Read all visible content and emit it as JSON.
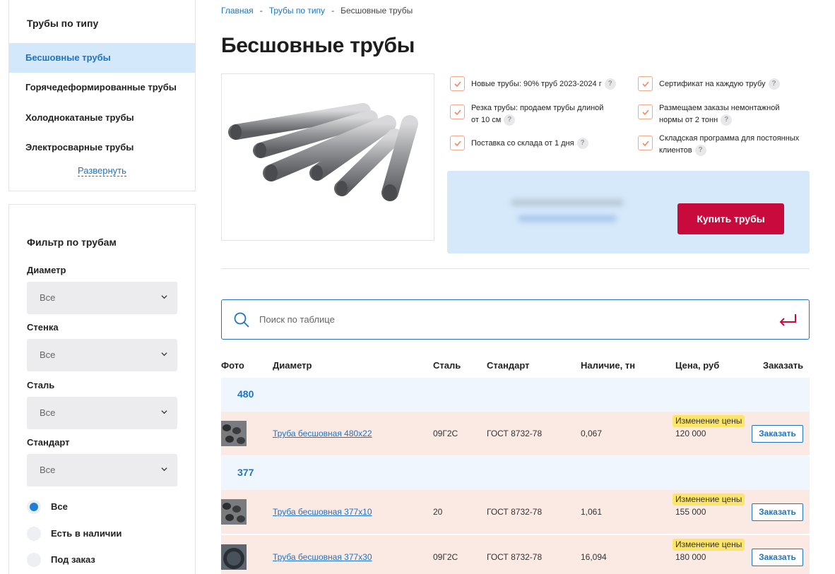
{
  "sidebar": {
    "types_title": "Трубы по типу",
    "types": [
      {
        "label": "Бесшовные трубы",
        "active": true
      },
      {
        "label": "Горячедеформированные трубы",
        "active": false
      },
      {
        "label": "Холоднокатаные трубы",
        "active": false
      },
      {
        "label": "Электросварные трубы",
        "active": false
      }
    ],
    "expand_label": "Развернуть",
    "filter_title": "Фильтр по трубам",
    "filters": [
      {
        "label": "Диаметр",
        "value": "Все"
      },
      {
        "label": "Стенка",
        "value": "Все"
      },
      {
        "label": "Сталь",
        "value": "Все"
      },
      {
        "label": "Стандарт",
        "value": "Все"
      }
    ],
    "availability": [
      {
        "label": "Все",
        "selected": true
      },
      {
        "label": "Есть в наличии",
        "selected": false
      },
      {
        "label": "Под заказ",
        "selected": false
      }
    ]
  },
  "breadcrumb": {
    "items": [
      "Главная",
      "Трубы по типу",
      "Бесшовные трубы"
    ],
    "separator": "-"
  },
  "page_title": "Бесшовные трубы",
  "features": [
    {
      "text": "Новые трубы: 90% труб 2023-2024 г"
    },
    {
      "text": "Сертификат на каждую трубу"
    },
    {
      "text_line1": "Резка трубы: продаем трубы длиной",
      "text_line2": "от 10 см"
    },
    {
      "text_line1": "Размещаем заказы немонтажной",
      "text_line2": "нормы от 2 тонн"
    },
    {
      "text": "Поставка со склада от 1 дня"
    },
    {
      "text_line1": "Складская программа для постоянных",
      "text_line2": "клиентов"
    }
  ],
  "help_icon": "?",
  "promo": {
    "buy_label": "Купить трубы"
  },
  "search": {
    "placeholder": "Поиск по таблице"
  },
  "table": {
    "headers": {
      "photo": "Фото",
      "diameter": "Диаметр",
      "steel": "Сталь",
      "standard": "Стандарт",
      "stock": "Наличие, тн",
      "price": "Цена, руб",
      "order": "Заказать"
    },
    "groups": [
      "480",
      "377"
    ],
    "rows": [
      {
        "name": "Труба бесшовная 480х22",
        "steel": "09Г2С",
        "standard": "ГОСТ 8732-78",
        "stock": "0,067",
        "badge": "Изменение цены",
        "price": "120 000",
        "order_label": "Заказать"
      },
      {
        "name": "Труба бесшовная 377х10",
        "steel": "20",
        "standard": "ГОСТ 8732-78",
        "stock": "1,061",
        "badge": "Изменение цены",
        "price": "155 000",
        "order_label": "Заказать"
      },
      {
        "name": "Труба бесшовная 377х30",
        "steel": "09Г2С",
        "standard": "ГОСТ 8732-78",
        "stock": "16,094",
        "badge": "Изменение цены",
        "price": "180 000",
        "order_label": "Заказать"
      }
    ]
  },
  "colors": {
    "accent_blue": "#1d74c3",
    "buy_button": "#c80b3c",
    "row_highlight": "#fbe9e4",
    "badge_yellow": "#fbe66b"
  }
}
